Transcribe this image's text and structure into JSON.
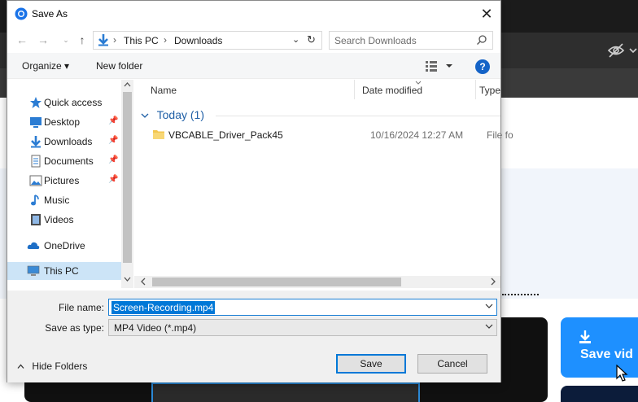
{
  "background": {
    "save_video_label": "Save vid"
  },
  "dialog": {
    "title": "Save As",
    "close_glyph": "✕",
    "address": {
      "back_glyph": "←",
      "forward_glyph": "→",
      "recent_glyph": "⌄",
      "up_glyph": "↑",
      "crumbs": [
        "This PC",
        "Downloads"
      ],
      "separator": "›",
      "dropdown_glyph": "⌄",
      "refresh_glyph": "↻"
    },
    "search": {
      "placeholder": "Search Downloads"
    },
    "commands": {
      "organize": "Organize ▾",
      "new_folder": "New folder",
      "help": "?"
    },
    "nav_pane": {
      "items": [
        {
          "label": "Quick access",
          "icon": "star-icon",
          "pinned": false
        },
        {
          "label": "Desktop",
          "icon": "desktop-icon",
          "pinned": true
        },
        {
          "label": "Downloads",
          "icon": "download-icon",
          "pinned": true
        },
        {
          "label": "Documents",
          "icon": "documents-icon",
          "pinned": true
        },
        {
          "label": "Pictures",
          "icon": "pictures-icon",
          "pinned": true
        },
        {
          "label": "Music",
          "icon": "music-icon",
          "pinned": false
        },
        {
          "label": "Videos",
          "icon": "videos-icon",
          "pinned": false
        },
        {
          "label": "OneDrive",
          "icon": "cloud-icon",
          "pinned": false
        },
        {
          "label": "This PC",
          "icon": "computer-icon",
          "pinned": false,
          "selected": true
        }
      ],
      "pin_glyph": "📌"
    },
    "file_list": {
      "columns": [
        "Name",
        "Date modified",
        "Type"
      ],
      "group_label": "Today (1)",
      "rows": [
        {
          "name": "VBCABLE_Driver_Pack45",
          "date": "10/16/2024 12:27 AM",
          "type": "File fo"
        }
      ]
    },
    "fields": {
      "file_name_label": "File name:",
      "file_name_value": "Screen-Recording.mp4",
      "save_type_label": "Save as type:",
      "save_type_value": "MP4 Video (*.mp4)"
    },
    "hide_folders": "Hide Folders",
    "buttons": {
      "save": "Save",
      "cancel": "Cancel"
    }
  },
  "colors": {
    "accent": "#0078d7",
    "selection": "#cce4f7",
    "group_text": "#1f5fa6",
    "bg_button": "#1e90ff"
  }
}
